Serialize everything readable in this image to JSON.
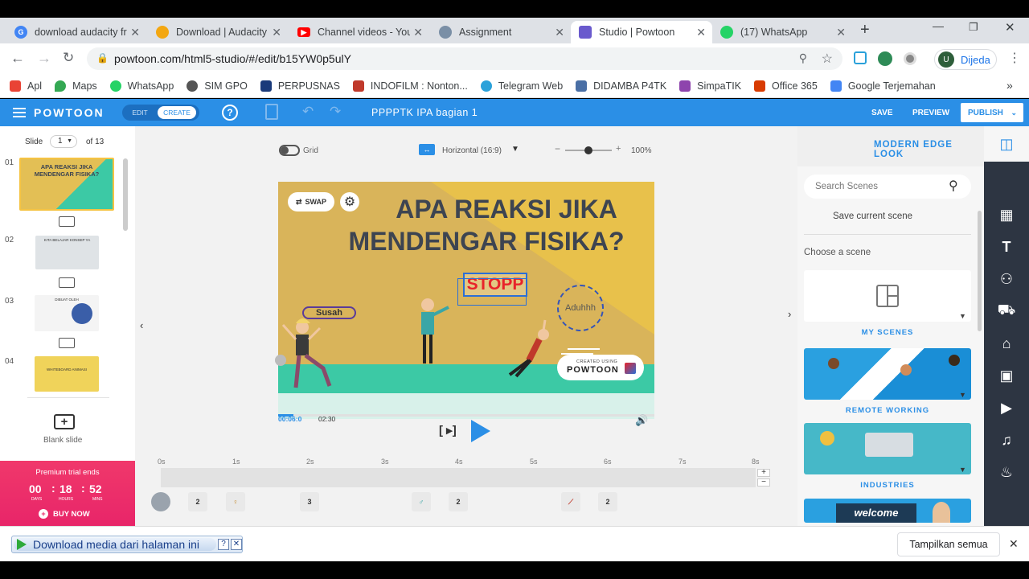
{
  "browser": {
    "tabs": [
      {
        "title": "download audacity fr",
        "icon": "google-icon",
        "color": "#4285f4"
      },
      {
        "title": "Download | Audacity",
        "icon": "audacity-icon",
        "color": "#f3a712"
      },
      {
        "title": "Channel videos - You",
        "icon": "youtube-icon",
        "color": "#ff0000"
      },
      {
        "title": "Assignment",
        "icon": "assignment-icon",
        "color": "#7a8fa6"
      },
      {
        "title": "Studio | Powtoon",
        "icon": "powtoon-icon",
        "color": "#6a5acd"
      },
      {
        "title": "(17) WhatsApp",
        "icon": "whatsapp-icon",
        "color": "#25d366"
      }
    ],
    "url": "powtoon.com/html5-studio/#/edit/b15YW0p5ulY",
    "profile_name": "Dijeda",
    "profile_initial": "U",
    "bookmarks": [
      {
        "label": "Apl",
        "color": "#e94335"
      },
      {
        "label": "Maps",
        "color": "#34a853"
      },
      {
        "label": "WhatsApp",
        "color": "#25d366"
      },
      {
        "label": "SIM GPO",
        "color": "#555555"
      },
      {
        "label": "PERPUSNAS",
        "color": "#1a3a7a"
      },
      {
        "label": "INDOFILM : Nonton...",
        "color": "#c0392b"
      },
      {
        "label": "Telegram Web",
        "color": "#2aa1da"
      },
      {
        "label": "DIDAMBA P4TK",
        "color": "#4a6fa5"
      },
      {
        "label": "SimpaTIK",
        "color": "#8e44ad"
      },
      {
        "label": "Office 365",
        "color": "#d83b01"
      },
      {
        "label": "Google Terjemahan",
        "color": "#4285f4"
      }
    ]
  },
  "powtoon": {
    "logo": "POWTOON",
    "mode_edit": "EDIT",
    "mode_create": "CREATE",
    "help": "?",
    "project_title": "PPPPTK IPA bagian 1",
    "save": "SAVE",
    "preview": "PREVIEW",
    "publish": "PUBLISH"
  },
  "slides_panel": {
    "label": "Slide",
    "current": "1",
    "of_total": "of 13",
    "slides": [
      {
        "number": "01",
        "caption": "APA REAKSI JIKA MENDENGAR FISIKA?"
      },
      {
        "number": "02",
        "caption": "KITA BELAJAR KONSEP YA"
      },
      {
        "number": "03",
        "caption": "DIBUAT OLEH"
      },
      {
        "number": "04",
        "caption": "WHITEBOARD ANIMASI"
      }
    ],
    "blank_slide": "Blank slide",
    "premium": {
      "title": "Premium trial ends",
      "days": "00",
      "hours": "18",
      "mins": "52",
      "days_label": "DAYS",
      "hours_label": "HOURS",
      "mins_label": "MINS",
      "buy": "BUY NOW"
    }
  },
  "canvas_toolbar": {
    "grid_label": "Grid",
    "orientation": "Horizontal (16:9)",
    "zoom": "100%",
    "zoom_level": 0.5
  },
  "slide": {
    "title_line1": "APA REAKSI JIKA",
    "title_line2": "MENDENGAR FISIKA?",
    "swap": "SWAP",
    "stop_text": "STOPP",
    "label_susah": "Susah",
    "label_aduhhh": "Aduhhh",
    "created_using": "CREATED USING",
    "brand": "POWTOON",
    "colors": {
      "bg_yellow": "#e8c14b",
      "bg_tan": "#d9b45a",
      "floor": "#3cc9a5",
      "title": "#3d4451",
      "stop": "#e8232a"
    }
  },
  "playback": {
    "current_time": "00:06:0",
    "total_time": "02:30",
    "progress": 0.04
  },
  "timeline": {
    "ticks": [
      "0s",
      "1s",
      "2s",
      "3s",
      "4s",
      "5s",
      "6s",
      "7s",
      "8s"
    ],
    "plus": "+",
    "minus": "−",
    "items": [
      {
        "label": "",
        "kind": "circle"
      },
      {
        "label": "2",
        "kind": "number"
      },
      {
        "label": "",
        "kind": "figure"
      },
      {
        "label": "3",
        "kind": "number"
      },
      {
        "label": "",
        "kind": "figure"
      },
      {
        "label": "2",
        "kind": "number"
      },
      {
        "label": "",
        "kind": "figure"
      },
      {
        "label": "2",
        "kind": "number"
      }
    ]
  },
  "scenes_panel": {
    "style": "MODERN EDGE LOOK",
    "search_placeholder": "Search Scenes",
    "save_current": "Save current scene",
    "choose": "Choose a scene",
    "categories": [
      "MY SCENES",
      "REMOTE WORKING",
      "INDUSTRIES"
    ],
    "welcome_text": "welcome"
  },
  "download_bar": {
    "button": "Download media dari halaman ini",
    "show_all": "Tampilkan semua"
  }
}
